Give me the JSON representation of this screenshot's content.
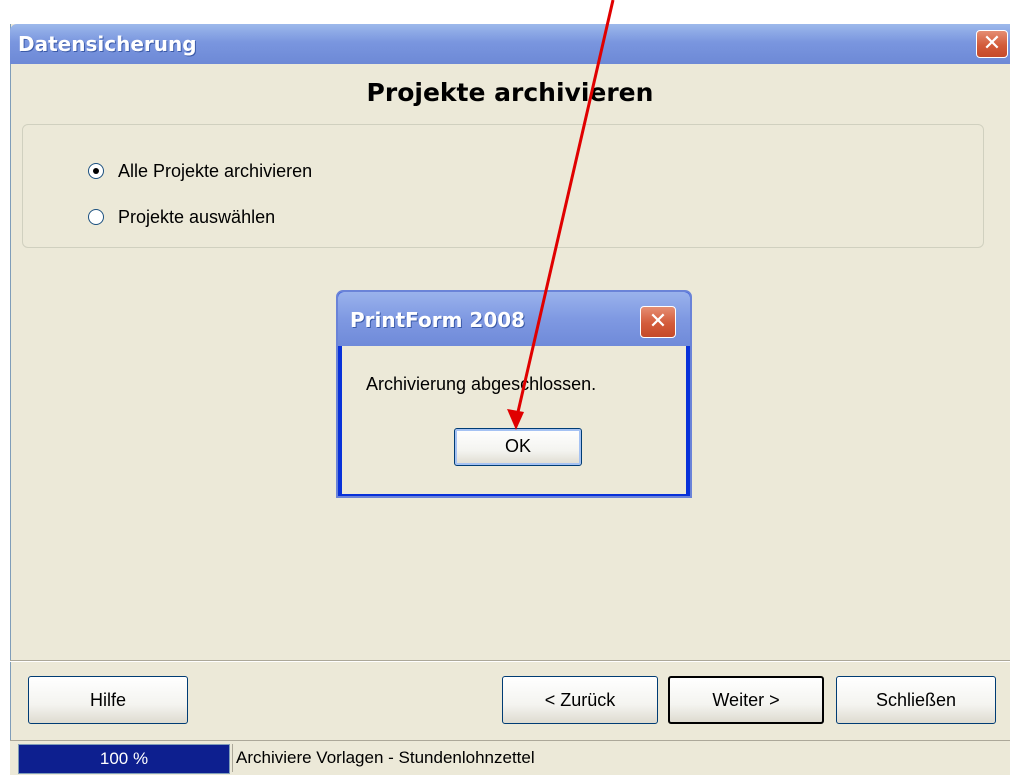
{
  "window": {
    "title": "Datensicherung",
    "close_icon": "close-icon"
  },
  "page": {
    "heading": "Projekte archivieren"
  },
  "options": [
    {
      "label": "Alle Projekte archivieren",
      "checked": true
    },
    {
      "label": "Projekte auswählen",
      "checked": false
    }
  ],
  "dialog": {
    "title": "PrintForm 2008",
    "message": "Archivierung abgeschlossen.",
    "ok_label": "OK"
  },
  "buttons": {
    "help": "Hilfe",
    "back": "< Zurück",
    "next": "Weiter >",
    "close": "Schließen"
  },
  "status": {
    "progress_text": "100 %",
    "progress": 1.0,
    "message": "Archiviere Vorlagen - Stundenlohnzettel"
  },
  "colors": {
    "annotation_arrow": "#e00000",
    "titlebar": "#7a96df",
    "window_bg": "#ece9d8"
  }
}
